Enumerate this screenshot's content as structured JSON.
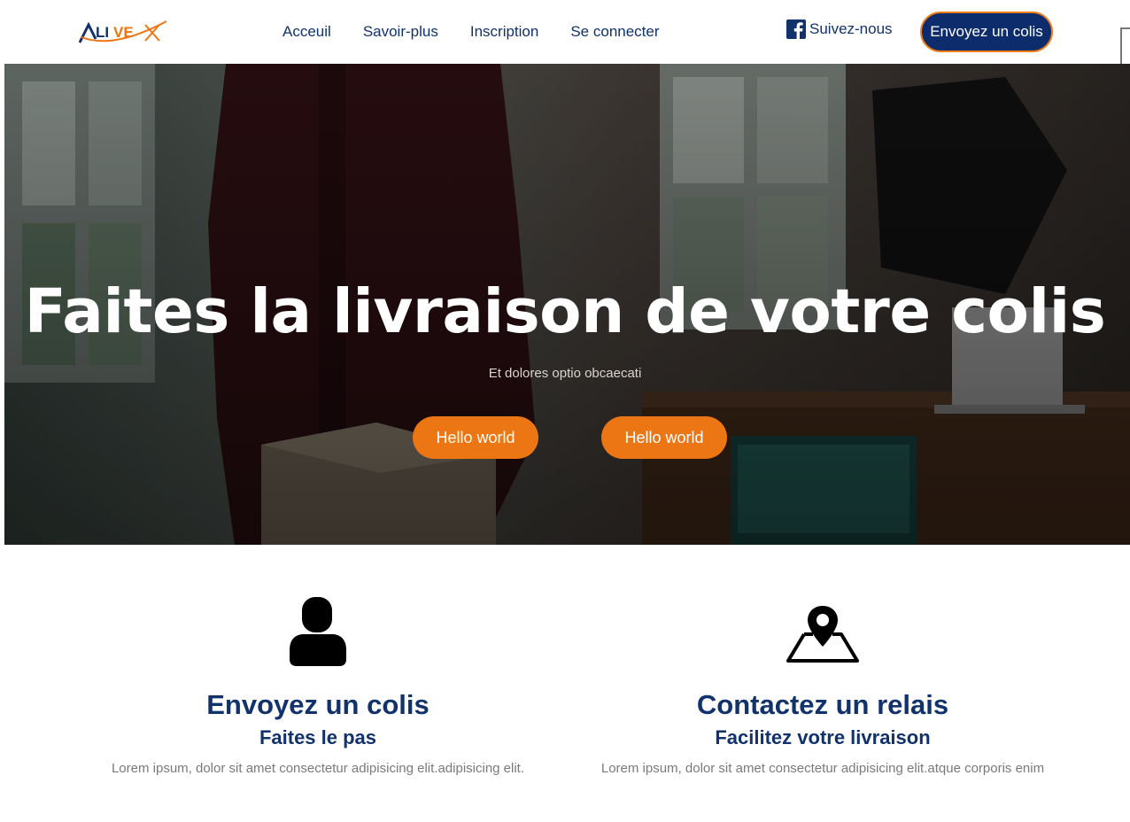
{
  "brand": {
    "logo_text": "ALIVEX",
    "primary_color": "#12326b",
    "accent_color": "#ec7613"
  },
  "nav": {
    "links": [
      {
        "label": "Acceuil"
      },
      {
        "label": "Savoir-plus"
      },
      {
        "label": "Inscription"
      },
      {
        "label": "Se connecter"
      }
    ],
    "follow": {
      "icon": "facebook-icon",
      "label": "Suivez-nous"
    },
    "cta_label": "Envoyez un colis"
  },
  "hero": {
    "title": "Faites la livraison de votre colis",
    "subtitle": "Et dolores optio obcaecati",
    "buttons": [
      {
        "label": "Hello world"
      },
      {
        "label": "Hello world"
      }
    ]
  },
  "features": [
    {
      "icon": "user-icon",
      "title": "Envoyez un colis",
      "subtitle": "Faites le pas",
      "description": "Lorem ipsum, dolor sit amet consectetur adipisicing elit.adipisicing elit."
    },
    {
      "icon": "map-pin-icon",
      "title": "Contactez un relais",
      "subtitle": "Facilitez votre livraison",
      "description": "Lorem ipsum, dolor sit amet consectetur adipisicing elit.atque corporis enim"
    }
  ]
}
